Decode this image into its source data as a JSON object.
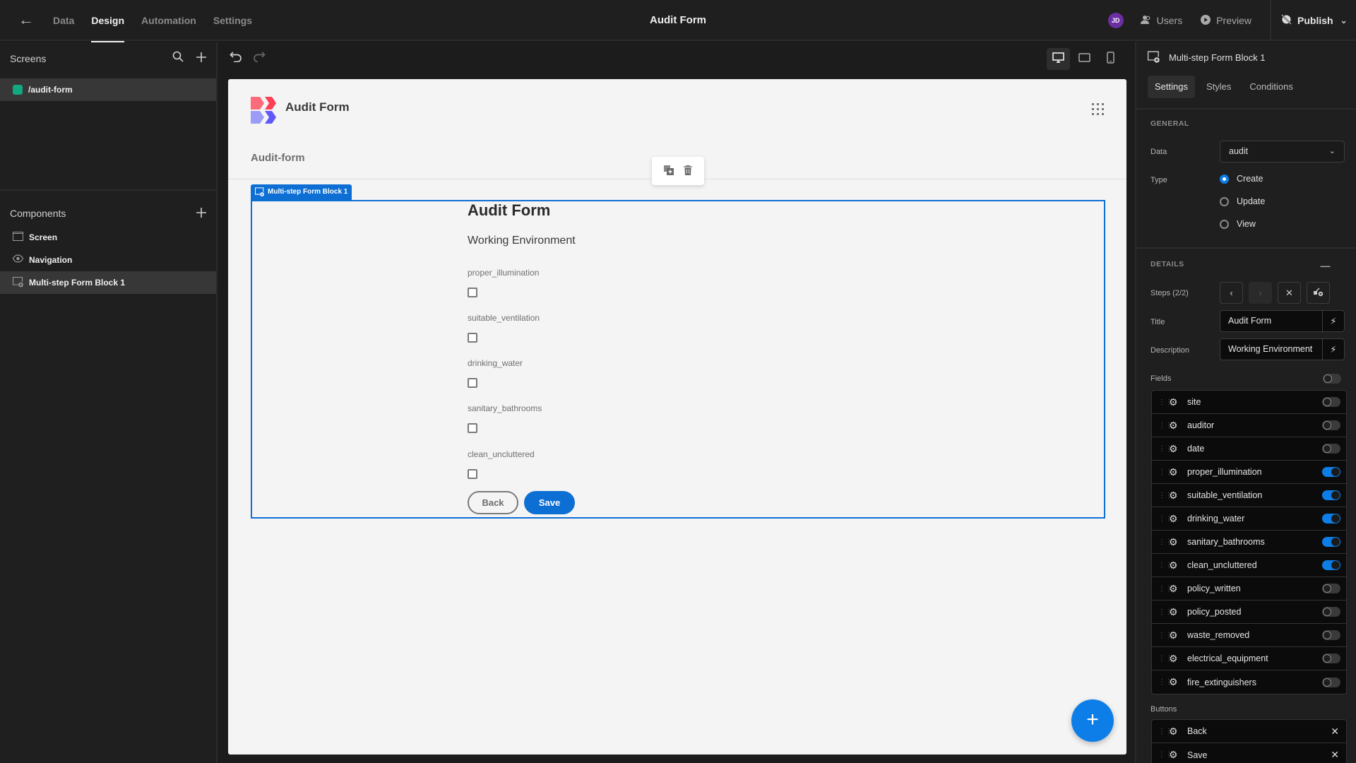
{
  "topbar": {
    "tabs": [
      {
        "label": "Data",
        "active": false
      },
      {
        "label": "Design",
        "active": true
      },
      {
        "label": "Automation",
        "active": false
      },
      {
        "label": "Settings",
        "active": false
      }
    ],
    "app_title": "Audit Form",
    "avatar_initials": "JD",
    "avatar_color": "#6b2fa3",
    "users_label": "Users",
    "preview_label": "Preview",
    "publish_label": "Publish"
  },
  "left_panel": {
    "screens_title": "Screens",
    "screens": [
      {
        "label": "/audit-form",
        "color": "#12a881",
        "selected": true
      }
    ],
    "components_title": "Components",
    "components": [
      {
        "label": "Screen",
        "icon": "screen-icon",
        "selected": false
      },
      {
        "label": "Navigation",
        "icon": "eye-icon",
        "selected": false
      },
      {
        "label": "Multi-step Form Block 1",
        "icon": "form-block-icon",
        "selected": true
      }
    ]
  },
  "canvas": {
    "app_name": "Audit Form",
    "breadcrumb": "Audit-form",
    "block_tag": "Multi-step Form Block 1",
    "form": {
      "title": "Audit Form",
      "description": "Working Environment",
      "fields": [
        {
          "label": "proper_illumination",
          "checked": false
        },
        {
          "label": "suitable_ventilation",
          "checked": false
        },
        {
          "label": "drinking_water",
          "checked": false
        },
        {
          "label": "sanitary_bathrooms",
          "checked": false
        },
        {
          "label": "clean_uncluttered",
          "checked": false
        }
      ],
      "back_label": "Back",
      "save_label": "Save"
    },
    "fab_label": "+"
  },
  "right_panel": {
    "component_name": "Multi-step Form Block 1",
    "tabs": [
      {
        "label": "Settings",
        "active": true
      },
      {
        "label": "Styles",
        "active": false
      },
      {
        "label": "Conditions",
        "active": false
      }
    ],
    "general": {
      "section_title": "GENERAL",
      "data_label": "Data",
      "data_value": "audit",
      "type_label": "Type",
      "type_options": [
        {
          "label": "Create",
          "selected": true
        },
        {
          "label": "Update",
          "selected": false
        },
        {
          "label": "View",
          "selected": false
        }
      ]
    },
    "details": {
      "section_title": "DETAILS",
      "steps_label": "Steps (2/2)",
      "title_label": "Title",
      "title_value": "Audit Form",
      "description_label": "Description",
      "description_value": "Working Environment",
      "fields_label": "Fields",
      "fields_toggle": false,
      "fields": [
        {
          "name": "site",
          "enabled": false
        },
        {
          "name": "auditor",
          "enabled": false
        },
        {
          "name": "date",
          "enabled": false
        },
        {
          "name": "proper_illumination",
          "enabled": true
        },
        {
          "name": "suitable_ventilation",
          "enabled": true
        },
        {
          "name": "drinking_water",
          "enabled": true
        },
        {
          "name": "sanitary_bathrooms",
          "enabled": true
        },
        {
          "name": "clean_uncluttered",
          "enabled": true
        },
        {
          "name": "policy_written",
          "enabled": false
        },
        {
          "name": "policy_posted",
          "enabled": false
        },
        {
          "name": "waste_removed",
          "enabled": false
        },
        {
          "name": "electrical_equipment",
          "enabled": false
        },
        {
          "name": "fire_extinguishers",
          "enabled": false
        }
      ],
      "buttons_label": "Buttons",
      "buttons": [
        {
          "name": "Back"
        },
        {
          "name": "Save"
        }
      ]
    }
  }
}
